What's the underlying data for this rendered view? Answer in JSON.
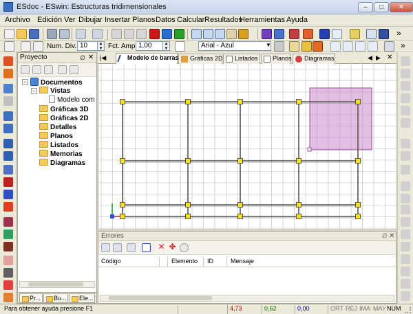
{
  "window": {
    "title": "ESdoc - ESwin: Estructuras tridimensionales"
  },
  "menu": [
    "Archivo",
    "Edición",
    "Ver",
    "Dibujar",
    "Insertar",
    "Planos",
    "Datos",
    "Calcular",
    "Resultados",
    "Herramientas",
    "Ayuda"
  ],
  "toolbar2": {
    "num_div_label": "Num. Div.",
    "num_div_value": "10",
    "fct_amp_label": "Fct. Amp.",
    "fct_amp_value": "1,00",
    "layer_value": "Arial - Azul"
  },
  "project": {
    "title": "Proyecto",
    "tree": {
      "root": "Documentos",
      "vistas": "Vistas",
      "modelo": "Modelo com",
      "items": [
        "Gráficas 3D",
        "Gráficas 2D",
        "Detalles",
        "Planos",
        "Listados",
        "Memorias",
        "Diagramas"
      ]
    },
    "tabs": [
      "Pr...",
      "Bu...",
      "Ele..."
    ]
  },
  "doc_tabs": [
    "Modelo de barras",
    "Gráficas 2D",
    "Listados",
    "Planos",
    "Diagramas"
  ],
  "errors": {
    "title": "Errores",
    "columns": [
      "Código",
      "Elemento",
      "ID",
      "Mensaje"
    ]
  },
  "status": {
    "help": "Para obtener ayuda presione F1",
    "x": "4,73",
    "y": "0,62",
    "z": "0,00",
    "indicators": [
      "ORT",
      "REJ",
      "IMA",
      "MAY",
      "NUM"
    ]
  },
  "colors": {
    "grid": "#b9b9b9",
    "node": "#f5e21c",
    "selection": "#cc88cc",
    "x_readout": "#c00000",
    "y_readout": "#007000",
    "z_readout": "#0000b0"
  }
}
